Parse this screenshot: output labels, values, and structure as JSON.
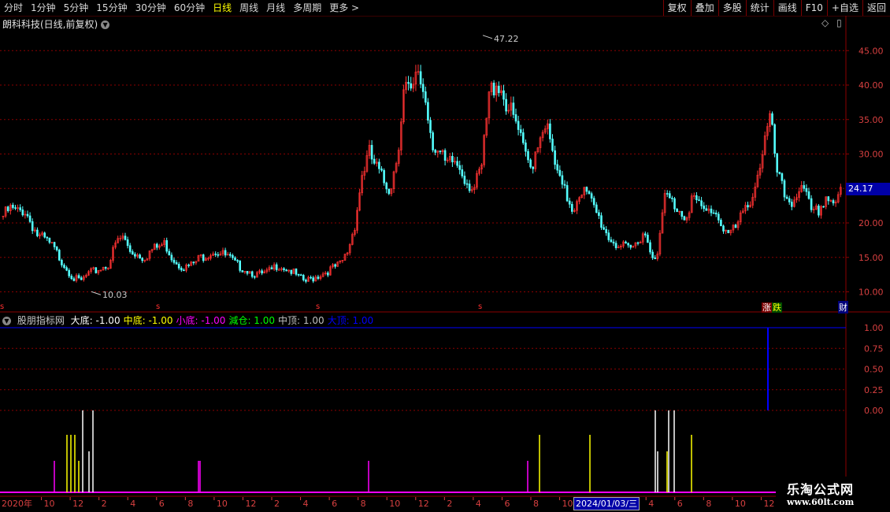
{
  "toolbar": {
    "periods": [
      "分时",
      "1分钟",
      "5分钟",
      "15分钟",
      "30分钟",
      "60分钟",
      "日线",
      "周线",
      "月线",
      "多周期",
      "更多 >"
    ],
    "active_period": "日线",
    "buttons": [
      "复权",
      "叠加",
      "多股",
      "统计",
      "画线",
      "F10",
      "+自选",
      "返回"
    ]
  },
  "chart_title": "朗科科技(日线,前复权)",
  "price_axis": [
    "45.00",
    "40.00",
    "35.00",
    "30.00",
    "25.00",
    "20.00",
    "15.00",
    "10.00"
  ],
  "current_price": "24.17",
  "annotations": {
    "high": "47.22",
    "low": "10.03"
  },
  "zhang": "涨",
  "die": "跌",
  "cai": "财",
  "indicator": {
    "name": "股朋指标网",
    "items": [
      {
        "label": "大底:",
        "value": "-1.00",
        "color": "#ffffff"
      },
      {
        "label": "中底:",
        "value": "-1.00",
        "color": "#ffff00"
      },
      {
        "label": "小底:",
        "value": "-1.00",
        "color": "#ff00ff"
      },
      {
        "label": "減仓:",
        "value": "1.00",
        "color": "#00ff00"
      },
      {
        "label": "中顶:",
        "value": "1.00",
        "color": "#c0c0c0"
      },
      {
        "label": "大顶:",
        "value": "1.00",
        "color": "#0000ff"
      }
    ]
  },
  "indicator_axis": [
    "1.00",
    "0.75",
    "0.50",
    "0.25",
    "0.00"
  ],
  "date_axis": [
    "2020年",
    "10",
    "12",
    "2",
    "4",
    "6",
    "8",
    "10",
    "12",
    "2",
    "4",
    "6",
    "8",
    "10",
    "12",
    "2",
    "4",
    "6",
    "8",
    "10",
    "12",
    "2",
    "4",
    "6",
    "8",
    "10",
    "12",
    "2"
  ],
  "date_cursor": "2024/01/03/三",
  "watermark": {
    "line1": "乐淘公式网",
    "line2": "www.60lt.com"
  },
  "colors": {
    "up": "#ff3232",
    "down": "#54ffff",
    "grid": "#8b0000",
    "ind_magenta": "#ff00ff",
    "ind_yellow": "#ffff00",
    "ind_white": "#ffffff",
    "ind_blue": "#0000ff"
  },
  "chart_data": {
    "type": "candlestick",
    "series_close": [
      21,
      22,
      21.5,
      22,
      20,
      18,
      17.5,
      16.5,
      15,
      13.5,
      12,
      11.5,
      12.5,
      13,
      13.5,
      14,
      17,
      18,
      16,
      15.5,
      15,
      16,
      16.5,
      17,
      15,
      14,
      13.5,
      14,
      15,
      15.5,
      16,
      15.5,
      15,
      14,
      13.5,
      13,
      12.5,
      12.5,
      13,
      14,
      13.5,
      13,
      12,
      11.5,
      12,
      12.5,
      13,
      13.5,
      14,
      16,
      20,
      27,
      30,
      28,
      26,
      25,
      30,
      40,
      38,
      42,
      38,
      32,
      30,
      28,
      29,
      28,
      26,
      25,
      28,
      38,
      41,
      39,
      36,
      34,
      30,
      28,
      32,
      35,
      30,
      26,
      24,
      22,
      25,
      24,
      22,
      20,
      18,
      17,
      16.5,
      16,
      17,
      19,
      16,
      15,
      24,
      23,
      22,
      21,
      24,
      22,
      21.5,
      22,
      20,
      18.5,
      19,
      21,
      23,
      26,
      31,
      35,
      27,
      24,
      23,
      25,
      24,
      21,
      22,
      24,
      23,
      24.17
    ],
    "y_range": [
      8,
      48
    ],
    "high": 47.22,
    "low": 10.03,
    "last": 24.17
  }
}
